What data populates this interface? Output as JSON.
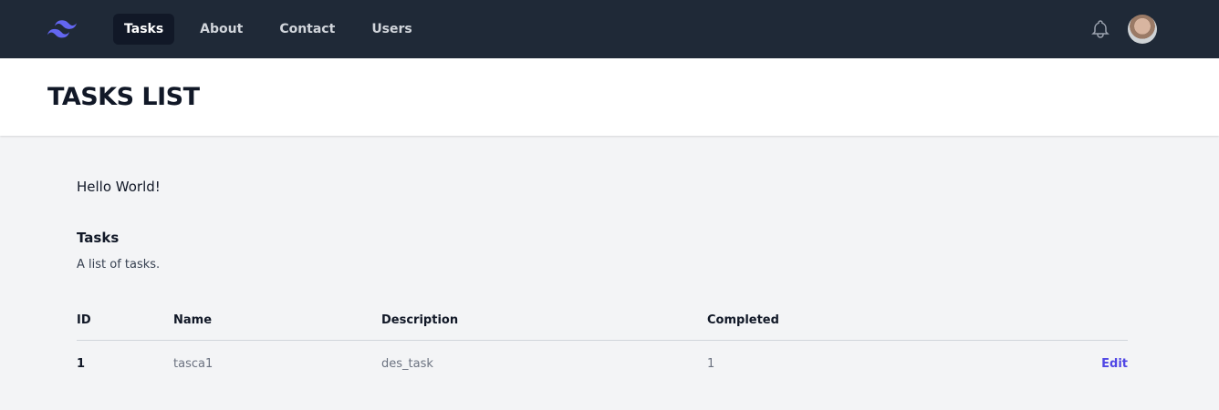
{
  "nav": {
    "links": [
      "Tasks",
      "About",
      "Contact",
      "Users"
    ],
    "active": "Tasks"
  },
  "header": {
    "title": "TASKS LIST"
  },
  "main": {
    "greeting": "Hello World!",
    "section_title": "Tasks",
    "section_desc": "A list of tasks.",
    "table": {
      "headers": [
        "ID",
        "Name",
        "Description",
        "Completed"
      ],
      "rows": [
        {
          "id": "1",
          "name": "tasca1",
          "description": "des_task",
          "completed": "1",
          "action": "Edit"
        }
      ]
    }
  },
  "colors": {
    "nav_bg": "#1f2937",
    "accent": "#4f46e5",
    "logo": "#6366f1"
  }
}
